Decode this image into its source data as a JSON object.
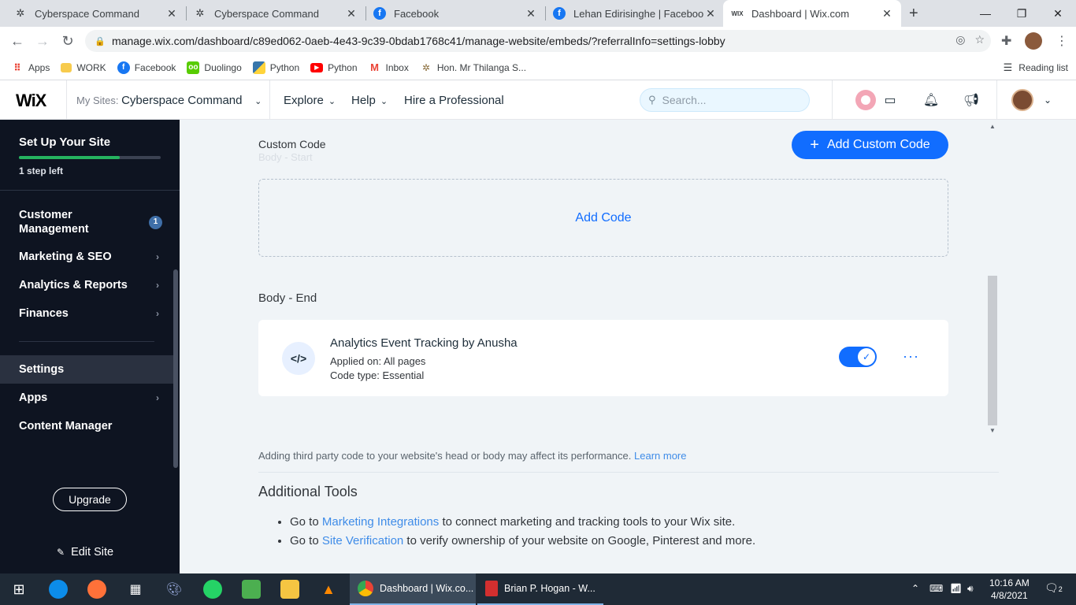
{
  "browser": {
    "tabs": [
      {
        "title": "Cyberspace Command",
        "icon": "cyberspace-favicon"
      },
      {
        "title": "Cyberspace Command",
        "icon": "cyberspace-favicon"
      },
      {
        "title": "Facebook",
        "icon": "facebook-favicon"
      },
      {
        "title": "Lehan Edirisinghe | Facebook",
        "icon": "facebook-favicon"
      },
      {
        "title": "Dashboard | Wix.com",
        "icon": "wix-favicon"
      }
    ],
    "url": "manage.wix.com/dashboard/c89ed062-0aeb-4e43-9c39-0bdab1768c41/manage-website/embeds/?referralInfo=settings-lobby",
    "bookmarks": [
      {
        "label": "Apps",
        "icon": "apps-grid-icon"
      },
      {
        "label": "WORK",
        "icon": "folder-icon"
      },
      {
        "label": "Facebook",
        "icon": "facebook-icon"
      },
      {
        "label": "Duolingo",
        "icon": "duolingo-icon"
      },
      {
        "label": "Python",
        "icon": "python-icon"
      },
      {
        "label": "Python",
        "icon": "youtube-icon"
      },
      {
        "label": "Inbox",
        "icon": "gmail-icon"
      },
      {
        "label": "Hon. Mr Thilanga S...",
        "icon": "emblem-icon"
      }
    ],
    "reading_list": "Reading list"
  },
  "wix": {
    "logo": "WiX",
    "my_sites_label": "My Sites:",
    "site_name": "Cyberspace Command",
    "nav": {
      "explore": "Explore",
      "help": "Help",
      "hire": "Hire a Professional"
    },
    "search_placeholder": "Search..."
  },
  "sidebar": {
    "setup_title": "Set Up Your Site",
    "progress": 0.71,
    "steps_left": "1 step left",
    "items": [
      {
        "label": "Customer Management",
        "badge": "1"
      },
      {
        "label": "Marketing & SEO"
      },
      {
        "label": "Analytics & Reports"
      },
      {
        "label": "Finances"
      },
      {
        "label": "Settings"
      },
      {
        "label": "Apps"
      },
      {
        "label": "Content Manager"
      }
    ],
    "upgrade": "Upgrade",
    "edit_site": "Edit Site"
  },
  "main": {
    "custom_code_title": "Custom Code",
    "ghost_label": "Body - Start",
    "add_custom_code": "Add Custom Code",
    "add_code": "Add Code",
    "body_end": "Body - End",
    "card": {
      "icon_text": "</>",
      "title": "Analytics Event Tracking by Anusha",
      "applied": "Applied on: All pages",
      "code_type": "Code type: Essential",
      "enabled": true
    },
    "notice": "Adding third party code to your website's head or body may affect its performance.",
    "learn_more": "Learn more",
    "additional_tools": "Additional Tools",
    "tools": [
      {
        "pre": "Go to ",
        "link": "Marketing Integrations",
        "post": " to connect marketing and tracking tools to your Wix site."
      },
      {
        "pre": "Go to ",
        "link": "Site Verification",
        "post": " to verify ownership of your website on Google, Pinterest and more."
      }
    ]
  },
  "taskbar": {
    "apps": [
      {
        "label": "Dashboard | Wix.co...",
        "icon": "chrome-icon"
      },
      {
        "label": "Brian P. Hogan - W...",
        "icon": "pdf-icon"
      }
    ],
    "time": "10:16 AM",
    "date": "4/8/2021",
    "notifications": "2"
  },
  "colors": {
    "accent": "#116dff",
    "sidebar_bg": "#0e1421",
    "progress": "#25b35f"
  }
}
